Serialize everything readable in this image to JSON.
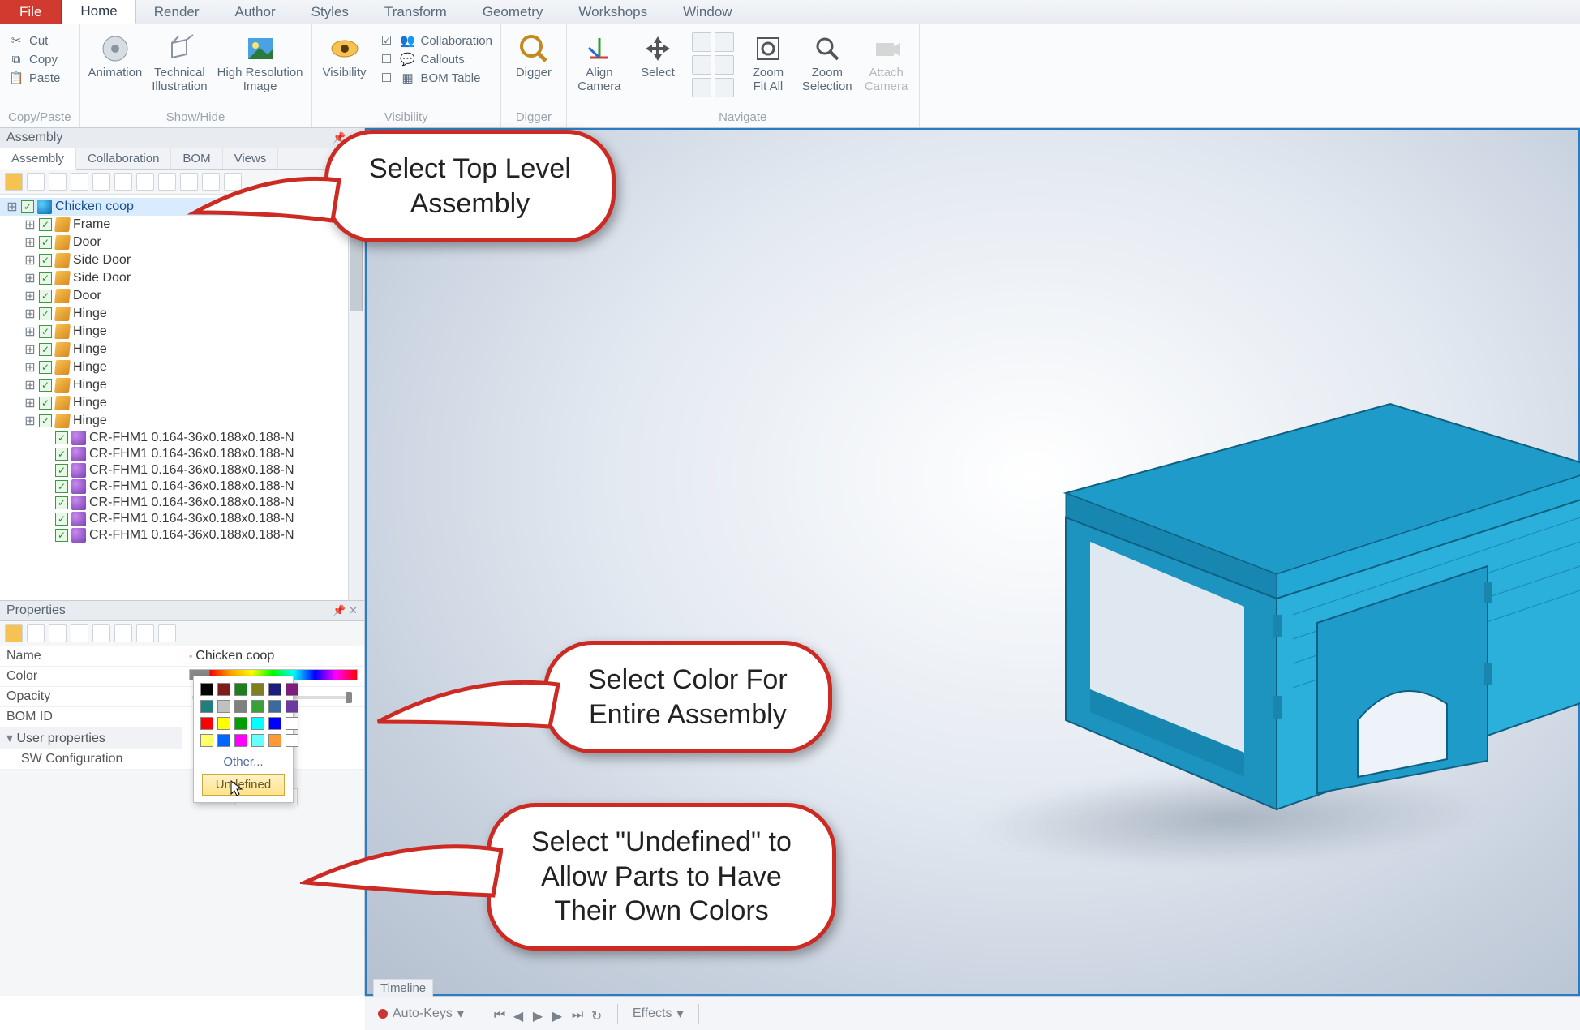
{
  "tabs": {
    "file": "File",
    "items": [
      "Home",
      "Render",
      "Author",
      "Styles",
      "Transform",
      "Geometry",
      "Workshops",
      "Window"
    ],
    "active": "Home"
  },
  "ribbon": {
    "clipboard": {
      "cut": "Cut",
      "copy": "Copy",
      "paste": "Paste",
      "group": "Copy/Paste"
    },
    "showhide": {
      "animation": "Animation",
      "techill": "Technical\nIllustration",
      "highres": "High Resolution\nImage",
      "group": "Show/Hide"
    },
    "visibility": {
      "visibility": "Visibility",
      "collab": "Collaboration",
      "callouts": "Callouts",
      "bom": "BOM Table",
      "group": "Visibility"
    },
    "digger": {
      "digger": "Digger",
      "group": "Digger"
    },
    "navigate": {
      "align": "Align\nCamera",
      "select": "Select",
      "zoomfit": "Zoom\nFit All",
      "zoomsel": "Zoom\nSelection",
      "attach": "Attach\nCamera",
      "group": "Navigate"
    }
  },
  "assemblyPanel": {
    "title": "Assembly",
    "subtabs": [
      "Assembly",
      "Collaboration",
      "BOM",
      "Views"
    ],
    "activeSubtab": "Assembly"
  },
  "tree": {
    "root": "Chicken coop",
    "children": [
      {
        "label": "Frame",
        "icon": "part"
      },
      {
        "label": "Door",
        "icon": "part"
      },
      {
        "label": "Side Door",
        "icon": "part"
      },
      {
        "label": "Side Door",
        "icon": "part"
      },
      {
        "label": "Door",
        "icon": "part"
      },
      {
        "label": "Hinge",
        "icon": "part"
      },
      {
        "label": "Hinge",
        "icon": "part"
      },
      {
        "label": "Hinge",
        "icon": "part"
      },
      {
        "label": "Hinge",
        "icon": "part"
      },
      {
        "label": "Hinge",
        "icon": "part"
      },
      {
        "label": "Hinge",
        "icon": "part"
      },
      {
        "label": "Hinge",
        "icon": "part"
      },
      {
        "label": "CR-FHM1 0.164-36x0.188x0.188-N",
        "icon": "sub"
      },
      {
        "label": "CR-FHM1 0.164-36x0.188x0.188-N",
        "icon": "sub"
      },
      {
        "label": "CR-FHM1 0.164-36x0.188x0.188-N",
        "icon": "sub"
      },
      {
        "label": "CR-FHM1 0.164-36x0.188x0.188-N",
        "icon": "sub"
      },
      {
        "label": "CR-FHM1 0.164-36x0.188x0.188-N",
        "icon": "sub"
      },
      {
        "label": "CR-FHM1 0.164-36x0.188x0.188-N",
        "icon": "sub"
      },
      {
        "label": "CR-FHM1 0.164-36x0.188x0.188-N",
        "icon": "sub"
      }
    ]
  },
  "properties": {
    "title": "Properties",
    "rows": {
      "name_label": "Name",
      "name_value": "Chicken coop",
      "color_label": "Color",
      "opacity_label": "Opacity",
      "bomid_label": "BOM ID",
      "userprops": "User properties",
      "swconfig": "SW Configuration"
    },
    "colorPopup": {
      "swatches": [
        "#000000",
        "#7f1d1d",
        "#1d7f1d",
        "#7f7f1d",
        "#1d1d7f",
        "#7f1d7f",
        "#1d7f7f",
        "#c0c0c0",
        "#808080",
        "#3aa03a",
        "#3a6aa0",
        "#6a3aa0",
        "#ff0000",
        "#ffff00",
        "#00a000",
        "#00ffff",
        "#0000ff",
        "#ffffff",
        "#ffff66",
        "#0066ff",
        "#ff00ff",
        "#66ffff",
        "#ff9933",
        "#ffffff"
      ],
      "other": "Other...",
      "undefined": "Undefined",
      "tooltip": "Undefined"
    }
  },
  "callouts": {
    "c1": "Select Top Level\nAssembly",
    "c2": "Select Color For\nEntire Assembly",
    "c3": "Select \"Undefined\" to\nAllow Parts to Have\nTheir Own Colors"
  },
  "timeline": {
    "title": "Timeline",
    "autokeys": "Auto-Keys",
    "effects": "Effects"
  }
}
